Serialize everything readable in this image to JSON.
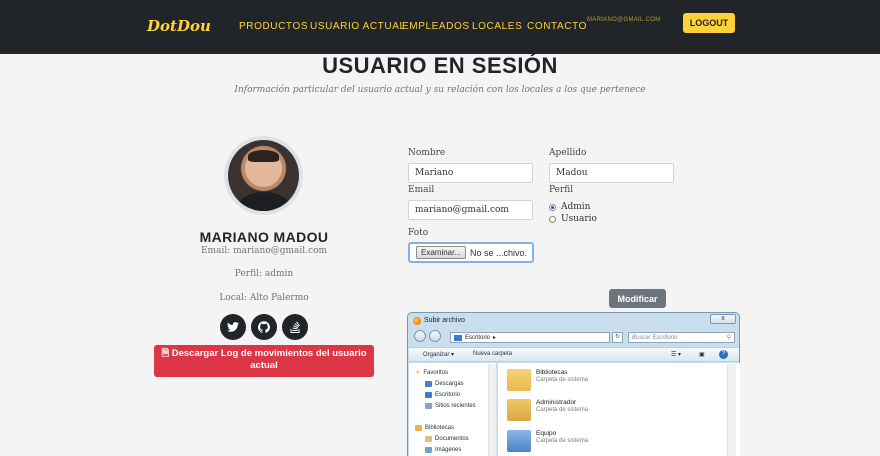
{
  "navbar": {
    "brand": "DotDou",
    "links": [
      "PRODUCTOS",
      "USUARIO ACTUAL",
      "EMPLEADOS",
      "LOCALES",
      "CONTACTO"
    ],
    "user_email": "MARIANO@GMAIL.COM",
    "logout_label": "LOGOUT"
  },
  "header": {
    "title": "USUARIO EN SESIÓN",
    "subtitle": "Información particular del usuario actual y su relación con los locales a los que pertenece"
  },
  "profile": {
    "name": "MARIANO MADOU",
    "email_line": "Email: mariano@gmail.com",
    "perfil_line": "Perfil: admin",
    "local_line": "Local: Alto Palermo",
    "social_icons": [
      "twitter-icon",
      "github-icon",
      "stack-overflow-icon"
    ],
    "download_label": "Descargar Log de movimientos del usuario actual"
  },
  "form": {
    "nombre_label": "Nombre",
    "nombre_value": "Mariano",
    "apellido_label": "Apellido",
    "apellido_value": "Madou",
    "email_label": "Email",
    "email_value": "mariano@gmail.com",
    "perfil_label": "Perfil",
    "perfil_options": [
      "Admin",
      "Usuario"
    ],
    "perfil_selected": "Admin",
    "foto_label": "Foto",
    "file_button": "Examinar...",
    "file_status": "No se ...chivo.",
    "submit_label": "Modificar"
  },
  "file_dialog": {
    "title": "Subir archivo",
    "close_label": "x",
    "path": "Escritorio",
    "search_placeholder": "Buscar Escritorio",
    "toolbar": {
      "organize": "Organizar ▾",
      "new_folder": "Nueva carpeta"
    },
    "tree": [
      {
        "label": "Favoritos",
        "color": "#f2c037"
      },
      {
        "label": "Descargas",
        "color": "#4a7fc1"
      },
      {
        "label": "Escritorio",
        "color": "#3a7bc8"
      },
      {
        "label": "Sitios recientes",
        "color": "#8aa3bd"
      },
      {
        "label": "Bibliotecas",
        "color": "#e6b34a"
      },
      {
        "label": "Documentos",
        "color": "#d9c27a"
      },
      {
        "label": "Imágenes",
        "color": "#6fa0d0"
      }
    ],
    "items": [
      {
        "name": "Bibliotecas",
        "type": "Carpeta de sistema",
        "color": "#e9b949"
      },
      {
        "name": "Administrador",
        "type": "Carpeta de sistema",
        "color": "#d9a842"
      },
      {
        "name": "Equipo",
        "type": "Carpeta de sistema",
        "color": "#4a83c4"
      }
    ]
  },
  "colors": {
    "accent": "#fed136",
    "navbar_bg": "#212529",
    "danger": "#dc3545",
    "secondary": "#6c757d"
  }
}
